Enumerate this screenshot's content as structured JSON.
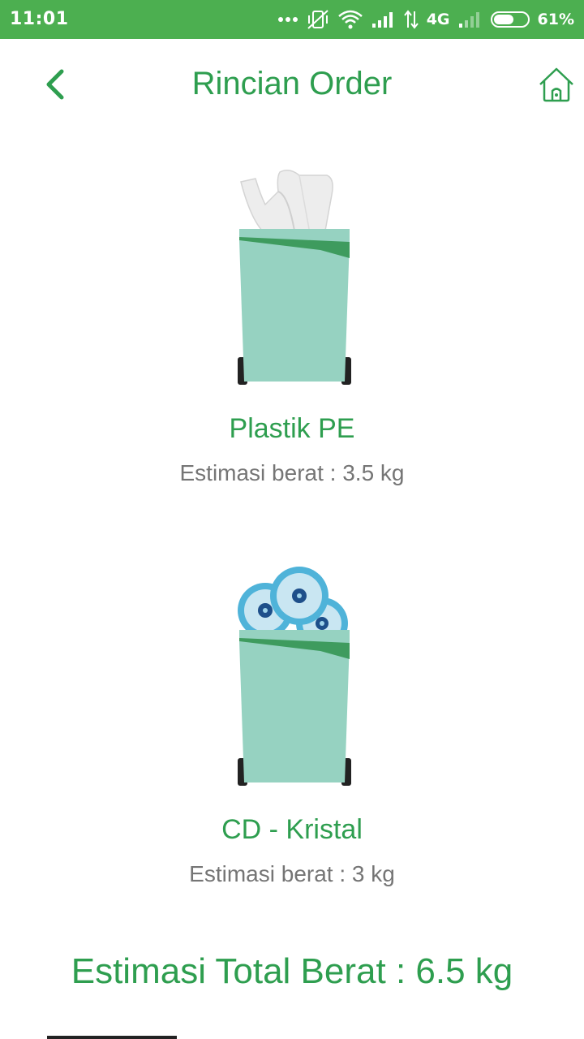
{
  "status_bar": {
    "time": "11:01",
    "network": "4G",
    "battery_text": "61%",
    "battery_level": 0.61,
    "icons": [
      "more-dots-icon",
      "vibrate-off-icon",
      "wifi-icon",
      "signal-icon",
      "data-arrows-icon",
      "signal-weak-icon",
      "battery-icon"
    ]
  },
  "header": {
    "title": "Rincian Order",
    "back_icon": "chevron-left-icon",
    "home_icon": "home-icon"
  },
  "items": [
    {
      "name": "Plastik PE",
      "weight": "Estimasi berat : 3.5 kg",
      "icon": "trash-bin-plastic-icon"
    },
    {
      "name": "CD - Kristal",
      "weight": "Estimasi berat : 3 kg",
      "icon": "trash-bin-cd-icon"
    }
  ],
  "total": "Estimasi Total Berat : 6.5 kg",
  "colors": {
    "status_bar": "#4caf50",
    "accent": "#2e9e4f",
    "secondary_text": "#757575",
    "bin_body": "#96d2c1",
    "bin_stripe": "#3e9b5e",
    "cd_blue": "#4fb3d9"
  }
}
